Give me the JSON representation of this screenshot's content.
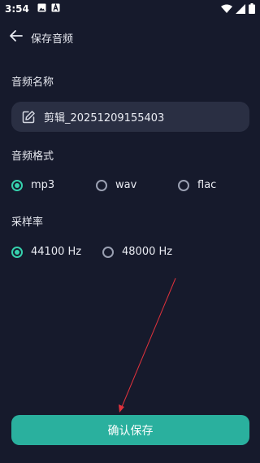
{
  "status_bar": {
    "time": "3:54",
    "left_icons": [
      "image-icon",
      "font-a-icon"
    ],
    "right_icons": [
      "wifi-icon",
      "signal-icon",
      "battery-icon"
    ]
  },
  "app_bar": {
    "back_icon": "arrow-left-icon",
    "title": "保存音频"
  },
  "name_section": {
    "label": "音频名称",
    "field_icon": "edit-icon",
    "value": "剪辑_20251209155403"
  },
  "format_section": {
    "label": "音频格式",
    "options": [
      {
        "label": "mp3",
        "selected": true
      },
      {
        "label": "wav",
        "selected": false
      },
      {
        "label": "flac",
        "selected": false
      }
    ]
  },
  "sample_rate_section": {
    "label": "采样率",
    "options": [
      {
        "label": "44100 Hz",
        "selected": true
      },
      {
        "label": "48000 Hz",
        "selected": false
      }
    ]
  },
  "confirm_button": {
    "label": "确认保存"
  },
  "colors": {
    "background": "#161a2c",
    "field_bg": "#2a2f43",
    "accent": "#36d1ad",
    "button": "#2ab09e",
    "annotation_arrow": "#e0323c"
  }
}
